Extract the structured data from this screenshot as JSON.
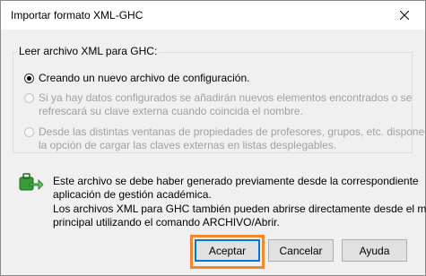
{
  "window": {
    "title": "Importar formato XML-GHC",
    "close_icon": "close-icon"
  },
  "group": {
    "legend": "Leer archivo XML para GHC:",
    "options": [
      {
        "lines": [
          "Creando un nuevo archivo de configuración."
        ],
        "selected": true,
        "enabled": true
      },
      {
        "lines": [
          "Si ya hay datos configurados se añadirán nuevos elementos encontrados o se",
          "refrescará su clave externa cuando coincida el nombre."
        ],
        "selected": false,
        "enabled": false
      },
      {
        "lines": [
          "Desde las distintas ventanas de propiedades de profesores, grupos, etc. dispone de",
          "la opción de cargar las claves externas en listas desplegables."
        ],
        "selected": false,
        "enabled": false
      }
    ]
  },
  "info": {
    "icon": "import-arrow-icon",
    "lines": [
      "Este archivo se debe haber generado previamente desde la correspondiente",
      "aplicación de gestión académica.",
      "Los archivos XML para GHC también pueden abrirse directamente desde el menú",
      "principal utilizando el comando ARCHIVO/Abrir."
    ]
  },
  "buttons": {
    "accept": "Aceptar",
    "cancel": "Cancelar",
    "help": "Ayuda"
  },
  "colors": {
    "highlight": "#f0892a",
    "accent": "#0078d7",
    "icon_green": "#3a9a3a"
  }
}
